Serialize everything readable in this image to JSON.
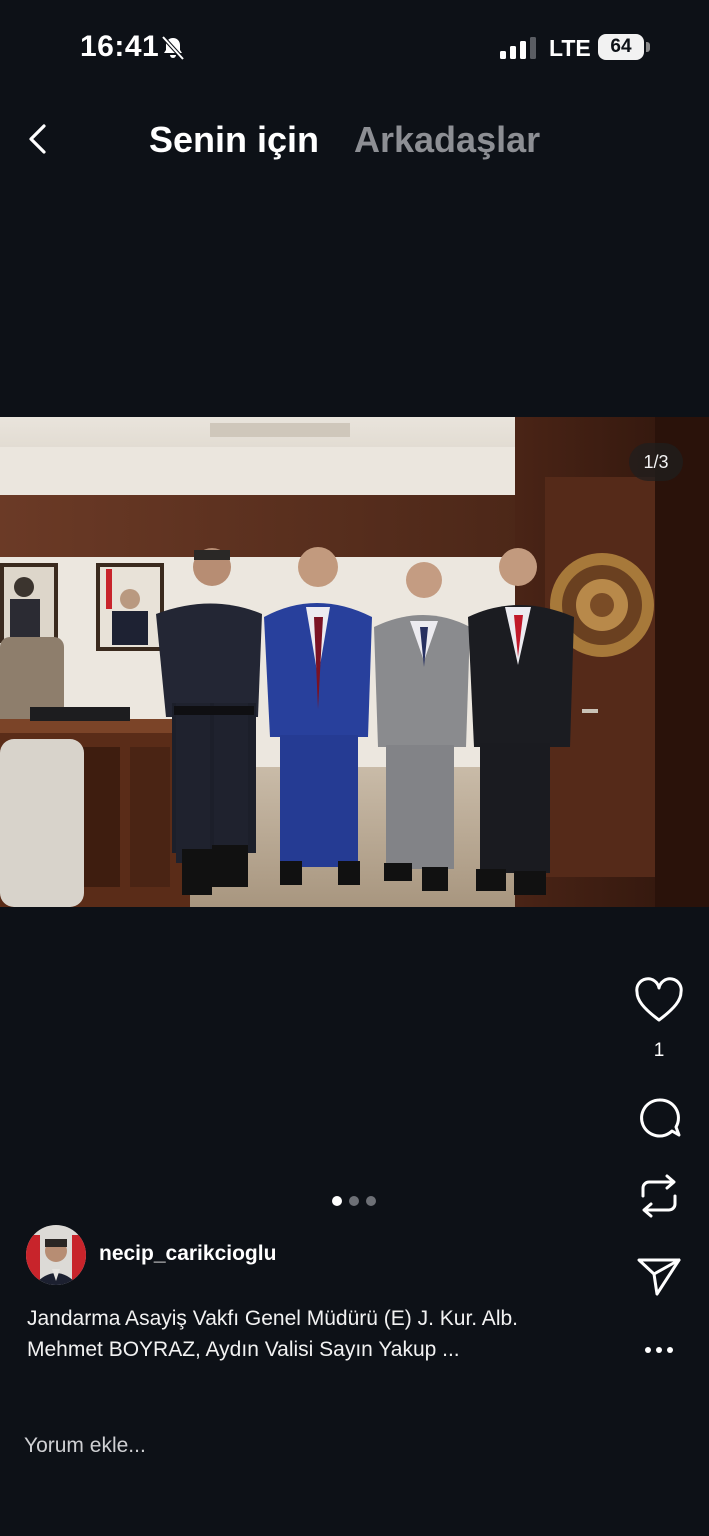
{
  "status_bar": {
    "time": "16:41",
    "network": "LTE",
    "battery": "64"
  },
  "nav": {
    "tab_for_you": "Senin için",
    "tab_friends": "Arkadaşlar"
  },
  "post": {
    "image_counter": "1/3",
    "image_count": 3,
    "active_image_index": 0,
    "username": "necip_carikcioglu",
    "caption_line_1": "Jandarma Asayiş Vakfı Genel Müdürü (E) J. Kur. Alb.",
    "caption_line_2": "Mehmet BOYRAZ, Aydın Valisi Sayın Yakup ...",
    "like_count": "1"
  },
  "actions": {
    "like_icon": "heart-icon",
    "comment_icon": "comment-bubble-icon",
    "repost_icon": "repost-icon",
    "share_icon": "send-icon",
    "more_icon": "more-dots-icon"
  },
  "comment": {
    "placeholder": "Yorum ekle..."
  },
  "colors": {
    "background": "#0d1117",
    "inactive_tab": "#8d8f94",
    "text": "#ffffff"
  }
}
